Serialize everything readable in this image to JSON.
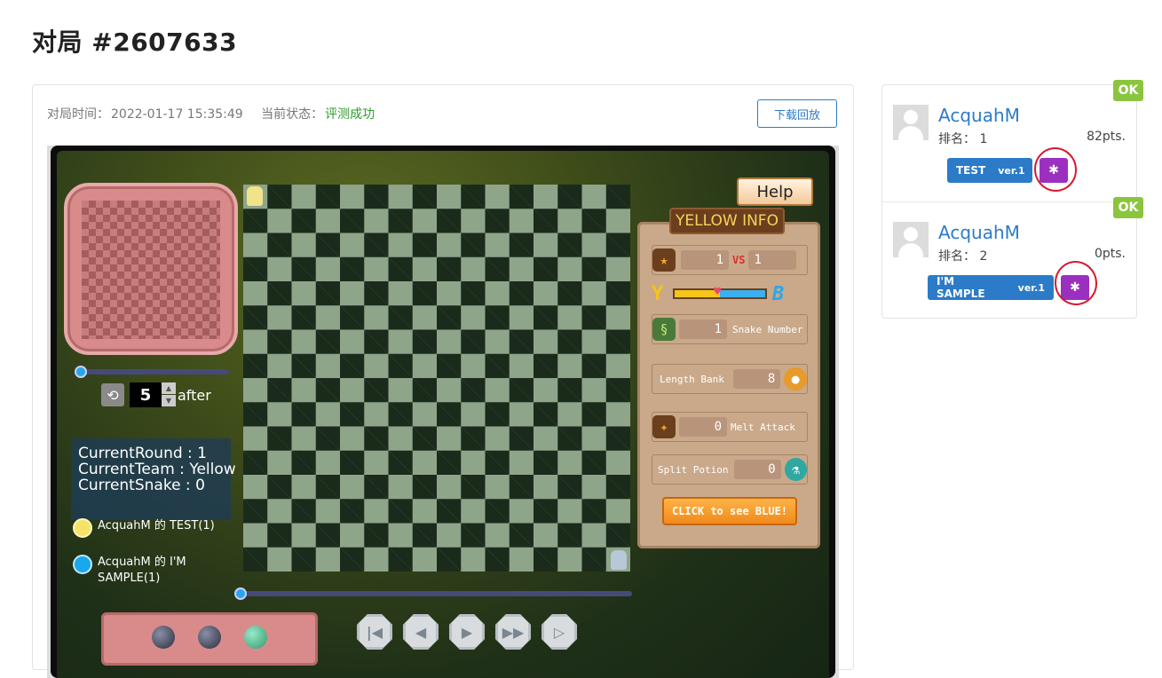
{
  "page": {
    "title": "对局 #2607633"
  },
  "meta": {
    "time_label": "对局时间：",
    "time_value": "2022-01-17 15:35:49",
    "status_label": "当前状态：",
    "status_value": "评测成功",
    "download_label": "下载回放"
  },
  "game": {
    "speed_value": "5",
    "speed_after": "after",
    "info": {
      "round": "CurrentRound :  1",
      "team": "CurrentTeam :  Yellow",
      "snake": "CurrentSnake :  0"
    },
    "players": [
      {
        "label": "AcquahM 的 TEST(1)",
        "color": "#f5e26a"
      },
      {
        "label": "AcquahM 的 I'M SAMPLE(1)",
        "color": "#1aa7ec"
      }
    ],
    "help_label": "Help",
    "panel_title": "YELLOW INFO",
    "score_yellow": "1",
    "score_blue": "1",
    "vs_label": "VS",
    "y_label": "Y",
    "b_label": "B",
    "snake_number": {
      "value": "1",
      "label": "Snake Number"
    },
    "length_bank": {
      "value": "8",
      "label": "Length Bank"
    },
    "melt_attack": {
      "value": "0",
      "label": "Melt Attack"
    },
    "split_potion": {
      "value": "0",
      "label": "Split Potion"
    },
    "click_label": "CLICK to see BLUE!"
  },
  "players": [
    {
      "status": "OK",
      "name": "AcquahM",
      "rank": "排名： 1",
      "pts": "82pts.",
      "bot": "TEST",
      "version": "ver.1",
      "bug_icon": "bug-icon"
    },
    {
      "status": "OK",
      "name": "AcquahM",
      "rank": "排名： 2",
      "pts": "0pts.",
      "bot": "I'M SAMPLE",
      "version": "ver.1",
      "bug_icon": "bug-icon"
    }
  ],
  "colors": {
    "accent_blue": "#2b7bc9",
    "ok_green": "#8bc53f",
    "bug_purple": "#9b30c0",
    "status_green": "#2e9b2e"
  }
}
